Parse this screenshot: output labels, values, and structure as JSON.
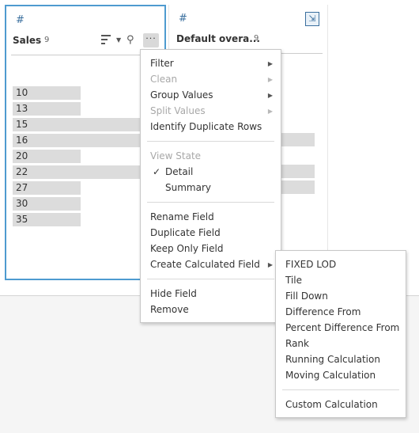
{
  "card1": {
    "type_icon": "#",
    "field_name": "Sales",
    "count": "9",
    "more_label": "···",
    "values": [
      {
        "label": "10",
        "fraction": 0.47
      },
      {
        "label": "13",
        "fraction": 0.47
      },
      {
        "label": "15",
        "fraction": 1.0
      },
      {
        "label": "16",
        "fraction": 1.0
      },
      {
        "label": "20",
        "fraction": 0.47
      },
      {
        "label": "22",
        "fraction": 1.0
      },
      {
        "label": "27",
        "fraction": 0.47
      },
      {
        "label": "30",
        "fraction": 0.47
      },
      {
        "label": "35",
        "fraction": 0.47
      }
    ]
  },
  "card2": {
    "type_icon": "#",
    "field_name": "Default overa...",
    "count": "9",
    "expand_icon": "expand-icon"
  },
  "menu": {
    "filter": "Filter",
    "clean": "Clean",
    "group_values": "Group Values",
    "split_values": "Split Values",
    "identify_duplicates": "Identify Duplicate Rows",
    "view_state": "View State",
    "detail": "Detail",
    "summary": "Summary",
    "rename_field": "Rename Field",
    "duplicate_field": "Duplicate Field",
    "keep_only_field": "Keep Only Field",
    "create_calculated_field": "Create Calculated Field",
    "hide_field": "Hide Field",
    "remove": "Remove",
    "check": "✓"
  },
  "submenu": {
    "fixed_lod": "FIXED LOD",
    "tile": "Tile",
    "fill_down": "Fill Down",
    "difference_from": "Difference From",
    "percent_difference_from": "Percent Difference From",
    "rank": "Rank",
    "running_calculation": "Running Calculation",
    "moving_calculation": "Moving Calculation",
    "custom_calculation": "Custom Calculation"
  },
  "colors": {
    "accent": "#4e9bd0",
    "bar": "#dcdcdc"
  }
}
